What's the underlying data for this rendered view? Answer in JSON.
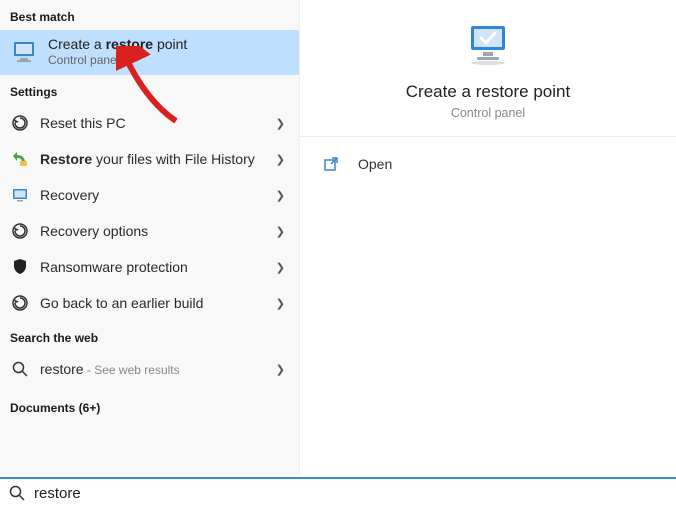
{
  "left": {
    "best_match_header": "Best match",
    "best_match": {
      "title_pre": "Create a ",
      "title_bold": "restore",
      "title_post": " point",
      "subtitle": "Control panel"
    },
    "settings_header": "Settings",
    "settings": [
      {
        "icon": "reset-pc-icon",
        "pre": "Reset this PC",
        "bold": "",
        "post": ""
      },
      {
        "icon": "file-history-icon",
        "pre": "",
        "bold": "Restore",
        "post": " your files with File History"
      },
      {
        "icon": "recovery-icon",
        "pre": "Recovery",
        "bold": "",
        "post": ""
      },
      {
        "icon": "recovery-options-icon",
        "pre": "Recovery options",
        "bold": "",
        "post": ""
      },
      {
        "icon": "shield-icon",
        "pre": "Ransomware protection",
        "bold": "",
        "post": ""
      },
      {
        "icon": "earlier-build-icon",
        "pre": "Go back to an earlier build",
        "bold": "",
        "post": ""
      }
    ],
    "search_web_header": "Search the web",
    "web": {
      "term": "restore",
      "suffix": " - See web results"
    },
    "documents_header": "Documents (6+)"
  },
  "right": {
    "title": "Create a restore point",
    "subtitle": "Control panel",
    "open_label": "Open"
  },
  "search": {
    "value": "restore"
  }
}
